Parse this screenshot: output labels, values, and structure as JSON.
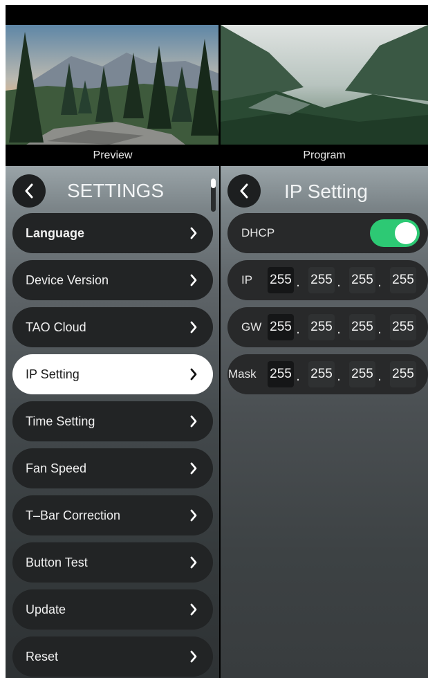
{
  "previews": {
    "left_label": "Preview",
    "right_label": "Program"
  },
  "settings": {
    "title": "SETTINGS",
    "items": [
      {
        "label": "Language"
      },
      {
        "label": "Device Version"
      },
      {
        "label": "TAO Cloud"
      },
      {
        "label": "IP Setting",
        "active": true
      },
      {
        "label": "Time Setting"
      },
      {
        "label": "Fan Speed"
      },
      {
        "label": "T–Bar Correction"
      },
      {
        "label": "Button Test"
      },
      {
        "label": "Update"
      },
      {
        "label": "Reset"
      }
    ]
  },
  "ip_setting": {
    "title": "IP Setting",
    "dhcp": {
      "label": "DHCP",
      "enabled": true
    },
    "ip": {
      "label": "IP",
      "octets": [
        "255",
        "255",
        "255",
        "255"
      ]
    },
    "gw": {
      "label": "GW",
      "octets": [
        "255",
        "255",
        "255",
        "255"
      ]
    },
    "mask": {
      "label": "Mask",
      "octets": [
        "255",
        "255",
        "255",
        "255"
      ]
    },
    "separator": "."
  },
  "colors": {
    "toggle_on": "#2dc974",
    "active_item": "#ffffff"
  },
  "icons": {
    "back": "chevron-left-icon",
    "item": "chevron-right-icon"
  }
}
